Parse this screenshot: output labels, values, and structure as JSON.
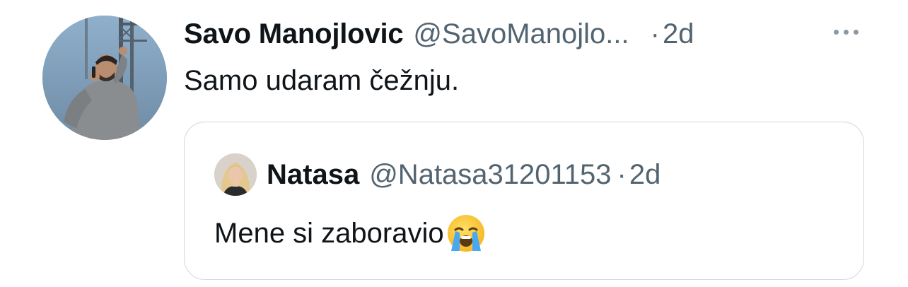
{
  "tweet": {
    "author": {
      "name": "Savo Manojlovic",
      "handle": "@SavoManojlo...",
      "avatar_icon": "user-avatar-photo"
    },
    "separator": "·",
    "time": "2d",
    "more_icon": "more-options-icon",
    "text": "Samo udaram čežnju."
  },
  "quoted_tweet": {
    "author": {
      "name": "Natasa",
      "handle": "@Natasa31201153",
      "avatar_icon": "user-avatar-photo"
    },
    "separator": "·",
    "time": "2d",
    "text": "Mene si zaboravio",
    "emoji_icon": "loudly-crying-face-emoji"
  },
  "colors": {
    "text_primary": "#0f1419",
    "text_secondary": "#536471",
    "border": "#cfd9de",
    "background": "#ffffff"
  }
}
